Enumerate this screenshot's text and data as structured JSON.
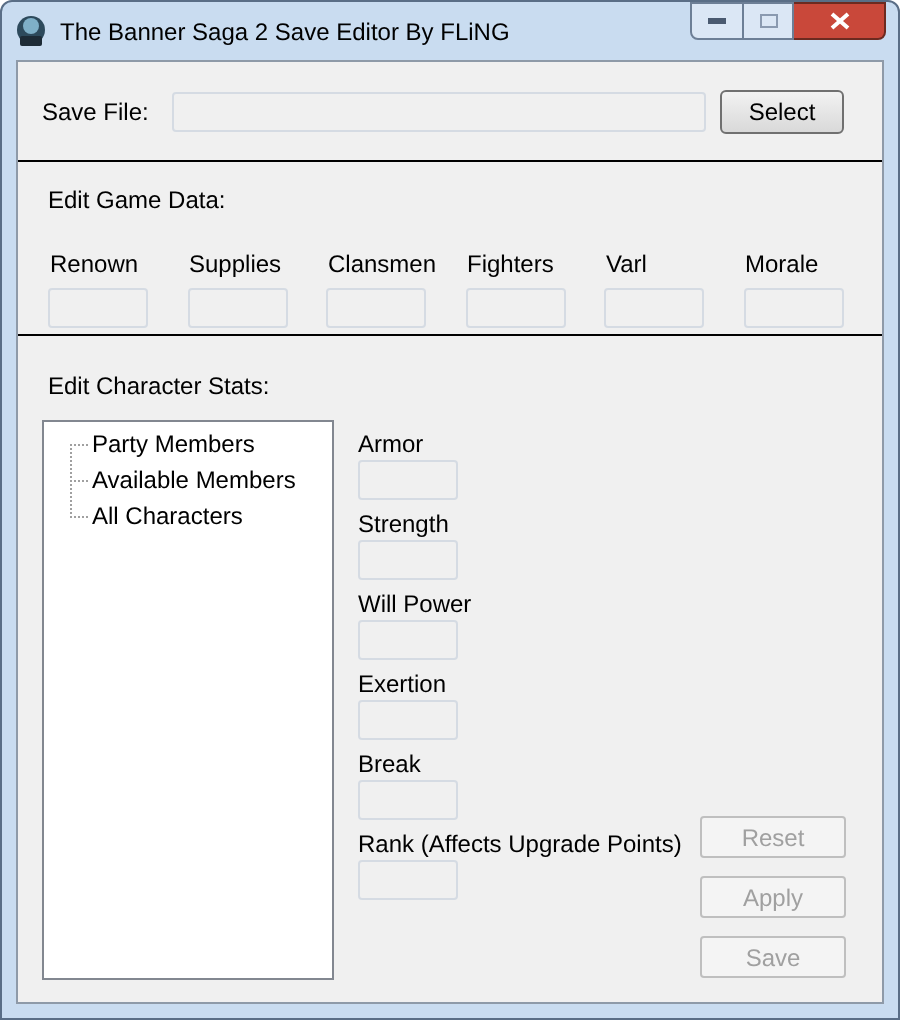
{
  "window": {
    "title": "The Banner Saga 2 Save Editor By FLiNG"
  },
  "save_file": {
    "label": "Save File:",
    "field": {
      "disabled": true
    },
    "button": {
      "label": "Select",
      "disabled": false
    }
  },
  "game_data": {
    "title": "Edit Game Data:",
    "fields": [
      {
        "label": "Renown",
        "disabled": true
      },
      {
        "label": "Supplies",
        "disabled": true
      },
      {
        "label": "Clansmen",
        "disabled": true
      },
      {
        "label": "Fighters",
        "disabled": true
      },
      {
        "label": "Varl",
        "disabled": true
      },
      {
        "label": "Morale",
        "disabled": true
      }
    ]
  },
  "character_stats": {
    "title": "Edit Character Stats:",
    "tree": [
      {
        "label": "Party Members",
        "selected": false
      },
      {
        "label": "Available Members",
        "selected": false
      },
      {
        "label": "All Characters",
        "selected": false
      }
    ],
    "fields": [
      {
        "label": "Armor",
        "disabled": true
      },
      {
        "label": "Strength",
        "disabled": true
      },
      {
        "label": "Will Power",
        "disabled": true
      },
      {
        "label": "Exertion",
        "disabled": true
      },
      {
        "label": "Break",
        "disabled": true
      },
      {
        "label": "Rank (Affects Upgrade Points)",
        "disabled": true
      }
    ],
    "buttons": [
      {
        "label": "Reset",
        "disabled": true
      },
      {
        "label": "Apply",
        "disabled": true
      },
      {
        "label": "Save",
        "disabled": true
      }
    ]
  }
}
